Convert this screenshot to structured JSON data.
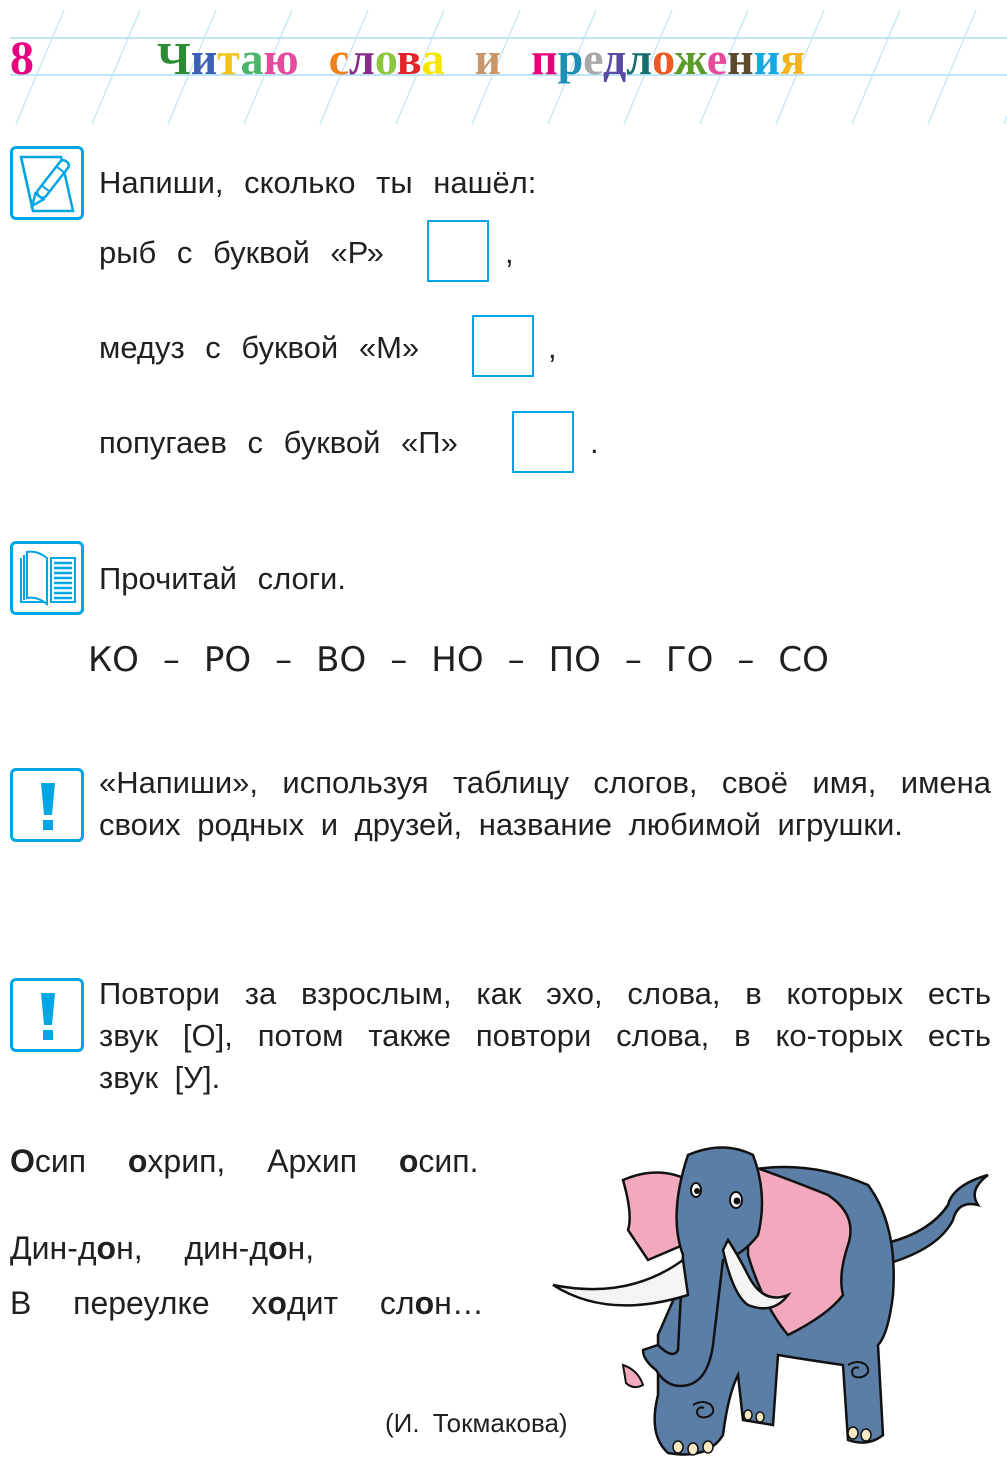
{
  "header": {
    "page_number": "8",
    "title_words": [
      {
        "letters": [
          {
            "ch": "Ч",
            "color": "#2e8b35"
          },
          {
            "ch": "и",
            "color": "#3a5fb4"
          },
          {
            "ch": "т",
            "color": "#f6c31b"
          },
          {
            "ch": "а",
            "color": "#4ab56a"
          },
          {
            "ch": "ю",
            "color": "#e54a9c"
          }
        ]
      },
      {
        "letters": [
          {
            "ch": "с",
            "color": "#f0811f"
          },
          {
            "ch": "л",
            "color": "#8a2b8c"
          },
          {
            "ch": "о",
            "color": "#8cc63f"
          },
          {
            "ch": "в",
            "color": "#e42229"
          },
          {
            "ch": "а",
            "color": "#f7e600"
          }
        ]
      },
      {
        "letters": [
          {
            "ch": "и",
            "color": "#c9956b"
          }
        ]
      },
      {
        "letters": [
          {
            "ch": "п",
            "color": "#e2007d"
          },
          {
            "ch": "р",
            "color": "#1b8fb5"
          },
          {
            "ch": "е",
            "color": "#a8a8a8"
          },
          {
            "ch": "д",
            "color": "#5a4aa3"
          },
          {
            "ch": "л",
            "color": "#176b6b"
          },
          {
            "ch": "о",
            "color": "#ef5a22"
          },
          {
            "ch": "ж",
            "color": "#5b9b2c"
          },
          {
            "ch": "е",
            "color": "#e54a9c"
          },
          {
            "ch": "н",
            "color": "#5c4a2e"
          },
          {
            "ch": "и",
            "color": "#16a8e0"
          },
          {
            "ch": "я",
            "color": "#f4b21b"
          }
        ]
      }
    ],
    "grid_color": "#bfe4f5"
  },
  "accent_color": "#00a6e4",
  "task1": {
    "icon": "pencil-paper-icon",
    "prompt": "Напиши, сколько ты нашёл:",
    "lines": [
      {
        "text": "рыб с буквой «Р»",
        "after": ","
      },
      {
        "text": "медуз с буквой «М»",
        "after": ","
      },
      {
        "text": "попугаев с буквой «П»",
        "after": "."
      }
    ]
  },
  "task2": {
    "icon": "open-book-icon",
    "prompt": "Прочитай слоги.",
    "syllables": [
      "КО",
      "РО",
      "ВО",
      "НО",
      "ПО",
      "ГО",
      "СО"
    ],
    "separator": "–"
  },
  "task3": {
    "icon": "exclamation-icon",
    "text": "«Напиши», используя таблицу слогов, своё имя, имена своих родных и друзей, название любимой игрушки."
  },
  "task4": {
    "icon": "exclamation-icon",
    "text": "Повтори за взрослым, как эхо, слова, в которых есть звук [О], потом также повтори слова, в ко-торых есть звук [У]."
  },
  "poem": {
    "line1": [
      {
        "t": "О",
        "b": true
      },
      {
        "t": "сип  "
      },
      {
        "t": "о",
        "b": true
      },
      {
        "t": "хрип,  Архип  "
      },
      {
        "t": "о",
        "b": true
      },
      {
        "t": "сип."
      }
    ],
    "line2": [
      {
        "t": "Дин-д"
      },
      {
        "t": "о",
        "b": true
      },
      {
        "t": "н,  дин-д"
      },
      {
        "t": "о",
        "b": true
      },
      {
        "t": "н,"
      }
    ],
    "line3": [
      {
        "t": "В  переулке  х"
      },
      {
        "t": "о",
        "b": true
      },
      {
        "t": "дит  сл"
      },
      {
        "t": "о",
        "b": true
      },
      {
        "t": "н…"
      }
    ],
    "author": "(И.  Токмакова)"
  },
  "illustration": {
    "subject": "elephant",
    "body_color": "#5b7ea6",
    "ear_color": "#f3a9bd",
    "tusk_color": "#f4f4f2"
  }
}
